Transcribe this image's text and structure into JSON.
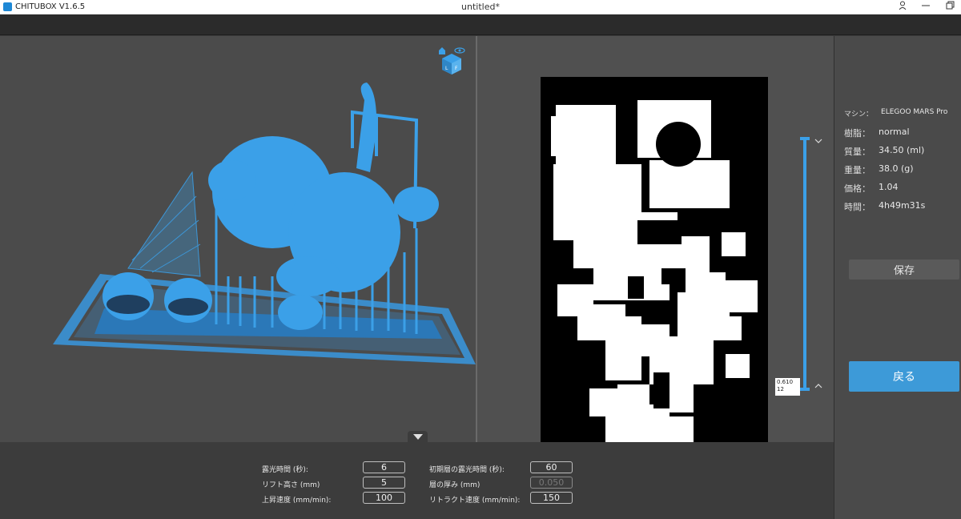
{
  "titlebar": {
    "app_name": "CHITUBOX V1.6.5",
    "document": "untitled*"
  },
  "info": {
    "machine_label": "マシン：",
    "machine_value": "ELEGOO MARS Pro",
    "resin_label": "樹脂：",
    "resin_value": "normal",
    "volume_label": "質量：",
    "volume_value": "34.50  (ml)",
    "weight_label": "重量：",
    "weight_value": "38.0  (g)",
    "price_label": "価格：",
    "price_value": "1.04",
    "time_label": "時間：",
    "time_value": "4h49m31s"
  },
  "buttons": {
    "save": "保存",
    "back": "戻る"
  },
  "layer_slider": {
    "height": "0.610",
    "layer": "12"
  },
  "params": {
    "exposure_label": "露光時間 (秒):",
    "exposure_value": "6",
    "bottom_exposure_label": "初期層の露光時間 (秒):",
    "bottom_exposure_value": "60",
    "lift_height_label": "リフト高さ (mm)",
    "lift_height_value": "5",
    "layer_thickness_label": "層の厚み (mm)",
    "layer_thickness_value": "0.050",
    "lift_speed_label": "上昇速度 (mm/min):",
    "lift_speed_value": "100",
    "retract_speed_label": "リトラクト速度 (mm/min):",
    "retract_speed_value": "150"
  },
  "colors": {
    "accent": "#3d9ad8",
    "model": "#3ba0e8",
    "panel": "#4a4a4a"
  },
  "icons": [
    "app-logo-icon",
    "user-icon",
    "minimize-icon",
    "maximize-icon",
    "view-cube-icon",
    "eye-icon",
    "home-icon",
    "chevron-down-icon",
    "chevron-up-icon"
  ]
}
